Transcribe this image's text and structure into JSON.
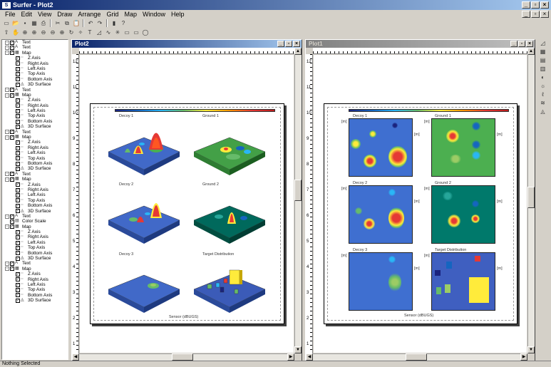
{
  "app": {
    "title": "Surfer - Plot2",
    "icon_text": "S"
  },
  "menu": [
    "File",
    "Edit",
    "View",
    "Draw",
    "Arrange",
    "Grid",
    "Map",
    "Window",
    "Help"
  ],
  "toolbar1": [
    "new-icon",
    "open-icon",
    "save-icon",
    "grid-icon",
    "print-icon",
    "|",
    "cut-icon",
    "copy-icon",
    "paste-icon",
    "|",
    "undo-icon",
    "redo-icon",
    "|",
    "pointer-icon",
    "help-icon"
  ],
  "toolbar1_glyphs": [
    "▭",
    "📂",
    "▪",
    "▦",
    "⎙",
    "|",
    "✂",
    "⧉",
    "📋",
    "|",
    "↶",
    "↷",
    "|",
    "▮",
    "?"
  ],
  "toolbar2_glyphs": [
    "⇧",
    "✋",
    "⊕",
    "⊕",
    "⊖",
    "⊖",
    "⊕",
    "↻",
    "✧",
    "T",
    "◿",
    "∿",
    "✳",
    "▭",
    "▭",
    "◯"
  ],
  "tree": [
    {
      "lvl": 0,
      "exp": "-",
      "chk": "✓",
      "ico": "A",
      "label": "Text"
    },
    {
      "lvl": 0,
      "exp": "-",
      "chk": "✓",
      "ico": "A",
      "label": "Text"
    },
    {
      "lvl": 0,
      "exp": "-",
      "chk": "✓",
      "ico": "▦",
      "label": "Map"
    },
    {
      "lvl": 1,
      "exp": "",
      "chk": "✓",
      "ico": "┈",
      "label": "Z Axis"
    },
    {
      "lvl": 1,
      "exp": "",
      "chk": "✓",
      "ico": "┈",
      "label": "Right Axis"
    },
    {
      "lvl": 1,
      "exp": "",
      "chk": "✓",
      "ico": "┈",
      "label": "Left Axis"
    },
    {
      "lvl": 1,
      "exp": "",
      "chk": "✓",
      "ico": "┈",
      "label": "Top Axis"
    },
    {
      "lvl": 1,
      "exp": "",
      "chk": "✓",
      "ico": "┈",
      "label": "Bottom Axis"
    },
    {
      "lvl": 1,
      "exp": "",
      "chk": "✓",
      "ico": "◬",
      "label": "3D Surface"
    },
    {
      "lvl": 0,
      "exp": "-",
      "chk": "✓",
      "ico": "A",
      "label": "Text"
    },
    {
      "lvl": 0,
      "exp": "-",
      "chk": "✓",
      "ico": "▦",
      "label": "Map"
    },
    {
      "lvl": 1,
      "exp": "",
      "chk": "✓",
      "ico": "┈",
      "label": "Z Axis"
    },
    {
      "lvl": 1,
      "exp": "",
      "chk": "✓",
      "ico": "┈",
      "label": "Right Axis"
    },
    {
      "lvl": 1,
      "exp": "",
      "chk": "✓",
      "ico": "┈",
      "label": "Left Axis"
    },
    {
      "lvl": 1,
      "exp": "",
      "chk": "✓",
      "ico": "┈",
      "label": "Top Axis"
    },
    {
      "lvl": 1,
      "exp": "",
      "chk": "✓",
      "ico": "┈",
      "label": "Bottom Axis"
    },
    {
      "lvl": 1,
      "exp": "",
      "chk": "✓",
      "ico": "◬",
      "label": "3D Surface"
    },
    {
      "lvl": 0,
      "exp": "-",
      "chk": "✓",
      "ico": "A",
      "label": "Text"
    },
    {
      "lvl": 0,
      "exp": "-",
      "chk": "✓",
      "ico": "▦",
      "label": "Map"
    },
    {
      "lvl": 1,
      "exp": "",
      "chk": "✓",
      "ico": "┈",
      "label": "Z Axis"
    },
    {
      "lvl": 1,
      "exp": "",
      "chk": "✓",
      "ico": "┈",
      "label": "Right Axis"
    },
    {
      "lvl": 1,
      "exp": "",
      "chk": "✓",
      "ico": "┈",
      "label": "Left Axis"
    },
    {
      "lvl": 1,
      "exp": "",
      "chk": "✓",
      "ico": "┈",
      "label": "Top Axis"
    },
    {
      "lvl": 1,
      "exp": "",
      "chk": "✓",
      "ico": "┈",
      "label": "Bottom Axis"
    },
    {
      "lvl": 1,
      "exp": "",
      "chk": "✓",
      "ico": "◬",
      "label": "3D Surface"
    },
    {
      "lvl": 0,
      "exp": "-",
      "chk": "✓",
      "ico": "A",
      "label": "Text"
    },
    {
      "lvl": 0,
      "exp": "-",
      "chk": "✓",
      "ico": "▦",
      "label": "Map"
    },
    {
      "lvl": 1,
      "exp": "",
      "chk": "✓",
      "ico": "┈",
      "label": "Z Axis"
    },
    {
      "lvl": 1,
      "exp": "",
      "chk": "✓",
      "ico": "┈",
      "label": "Right Axis"
    },
    {
      "lvl": 1,
      "exp": "",
      "chk": "✓",
      "ico": "┈",
      "label": "Left Axis"
    },
    {
      "lvl": 1,
      "exp": "",
      "chk": "✓",
      "ico": "┈",
      "label": "Top Axis"
    },
    {
      "lvl": 1,
      "exp": "",
      "chk": "✓",
      "ico": "┈",
      "label": "Bottom Axis"
    },
    {
      "lvl": 1,
      "exp": "",
      "chk": "✓",
      "ico": "◬",
      "label": "3D Surface"
    },
    {
      "lvl": 0,
      "exp": "-",
      "chk": "✓",
      "ico": "A",
      "label": "Text"
    },
    {
      "lvl": 0,
      "exp": "",
      "chk": "✓",
      "ico": "▤",
      "label": "Color Scale"
    },
    {
      "lvl": 0,
      "exp": "-",
      "chk": "✓",
      "ico": "▦",
      "label": "Map"
    },
    {
      "lvl": 1,
      "exp": "",
      "chk": "✓",
      "ico": "┈",
      "label": "Z Axis"
    },
    {
      "lvl": 1,
      "exp": "",
      "chk": "✓",
      "ico": "┈",
      "label": "Right Axis"
    },
    {
      "lvl": 1,
      "exp": "",
      "chk": "✓",
      "ico": "┈",
      "label": "Left Axis"
    },
    {
      "lvl": 1,
      "exp": "",
      "chk": "✓",
      "ico": "┈",
      "label": "Top Axis"
    },
    {
      "lvl": 1,
      "exp": "",
      "chk": "✓",
      "ico": "┈",
      "label": "Bottom Axis"
    },
    {
      "lvl": 1,
      "exp": "",
      "chk": "✓",
      "ico": "◬",
      "label": "3D Surface"
    },
    {
      "lvl": 0,
      "exp": "-",
      "chk": "✓",
      "ico": "A",
      "label": "Text"
    },
    {
      "lvl": 0,
      "exp": "-",
      "chk": "✓",
      "ico": "▦",
      "label": "Map"
    },
    {
      "lvl": 1,
      "exp": "",
      "chk": "✓",
      "ico": "┈",
      "label": "Z Axis"
    },
    {
      "lvl": 1,
      "exp": "",
      "chk": "✓",
      "ico": "┈",
      "label": "Right Axis"
    },
    {
      "lvl": 1,
      "exp": "",
      "chk": "✓",
      "ico": "┈",
      "label": "Left Axis"
    },
    {
      "lvl": 1,
      "exp": "",
      "chk": "✓",
      "ico": "┈",
      "label": "Top Axis"
    },
    {
      "lvl": 1,
      "exp": "",
      "chk": "✓",
      "ico": "┈",
      "label": "Bottom Axis"
    },
    {
      "lvl": 1,
      "exp": "",
      "chk": "✓",
      "ico": "◬",
      "label": "3D Surface"
    }
  ],
  "plot2": {
    "title": "Plot2",
    "ruler_v": [
      "12",
      "11",
      "10",
      "9",
      "8",
      "7",
      "6",
      "5",
      "4",
      "3",
      "2",
      "1"
    ],
    "panels": [
      {
        "label": "Decoy 1"
      },
      {
        "label": "Ground 1"
      },
      {
        "label": "Decoy 2"
      },
      {
        "label": "Ground 2"
      },
      {
        "label": "Decoy 3"
      },
      {
        "label": "Target Distribution"
      }
    ],
    "footer": "Sensor (dBUGS)"
  },
  "plot1": {
    "title": "Plot1",
    "ruler_v": [
      "12",
      "11",
      "10",
      "9",
      "8",
      "7",
      "6",
      "5",
      "4",
      "3",
      "2",
      "1"
    ],
    "panels": [
      {
        "label": "Decoy 1"
      },
      {
        "label": "Ground 1"
      },
      {
        "label": "Decoy 2"
      },
      {
        "label": "Ground 2"
      },
      {
        "label": "Decoy 3"
      },
      {
        "label": "Target Distribution"
      }
    ],
    "axis_unit": "[m]",
    "footer": "Sensor (dBUGS)"
  },
  "right_toolbar": [
    "◿",
    "▦",
    "▤",
    "▥",
    "◐",
    "☼",
    "ℓ",
    "≋",
    "◬"
  ],
  "status": "Nothing Selected"
}
